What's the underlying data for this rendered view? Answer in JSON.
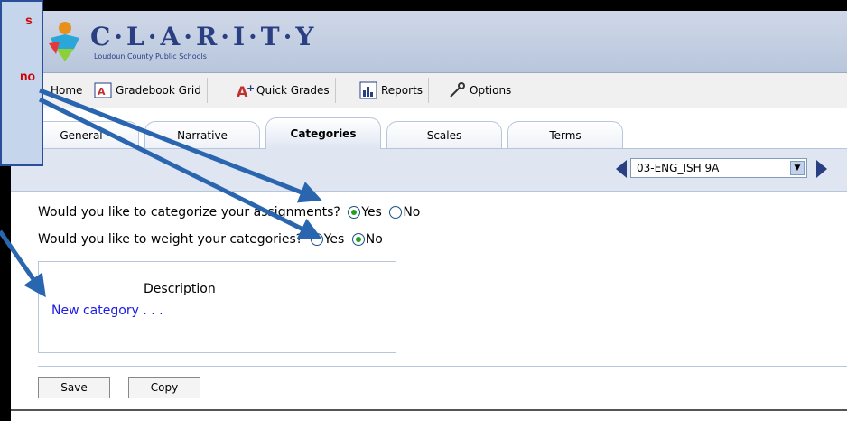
{
  "brand": {
    "title": "C·L·A·R·I·T·Y",
    "subtitle": "Loudoun County Public Schools"
  },
  "toolbar": [
    {
      "label": "Home",
      "icon": "home"
    },
    {
      "label": "Gradebook Grid",
      "icon": "gradebook-grid-icon"
    },
    {
      "label": "Quick Grades",
      "icon": "quick-grades-icon"
    },
    {
      "label": "Reports",
      "icon": "reports-icon"
    },
    {
      "label": "Options",
      "icon": "options-icon"
    }
  ],
  "tabs": [
    {
      "label": "General",
      "active": false
    },
    {
      "label": "Narrative",
      "active": false
    },
    {
      "label": "Categories",
      "active": true
    },
    {
      "label": "Scales",
      "active": false
    },
    {
      "label": "Terms",
      "active": false
    }
  ],
  "class_select": {
    "value": "03-ENG_ISH 9A"
  },
  "questions": {
    "categorize": {
      "text": "Would you like to categorize your assignments?",
      "yes": "Yes",
      "no": "No",
      "selected": "yes"
    },
    "weight": {
      "text": "Would you like to weight your categories?",
      "yes": "Yes",
      "no": "No",
      "selected": "no"
    }
  },
  "categories_table": {
    "header": "Description",
    "new_item": "New category . . ."
  },
  "buttons": {
    "save": "Save",
    "copy": "Copy"
  },
  "callout": {
    "line1": "s",
    "line2": "no"
  },
  "colors": {
    "brand": "#2a3e82",
    "callout_text": "#d10000",
    "link": "#1a1ae6"
  }
}
